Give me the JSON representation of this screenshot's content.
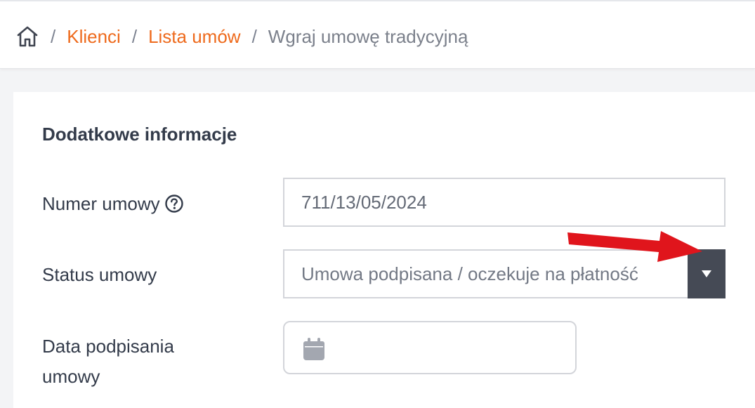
{
  "breadcrumb": {
    "home_icon": "home-icon",
    "separator": "/",
    "items": [
      {
        "label": "Klienci"
      },
      {
        "label": "Lista umów"
      }
    ],
    "current": "Wgraj umowę tradycyjną"
  },
  "form": {
    "section_title": "Dodatkowe informacje",
    "contract_number": {
      "label": "Numer umowy",
      "help_icon": "question-circle-icon",
      "value": "711/13/05/2024"
    },
    "contract_status": {
      "label": "Status umowy",
      "selected": "Umowa podpisana / oczekuje na płatność",
      "dropdown_icon": "triangle-down-icon"
    },
    "signing_date": {
      "label_line1": "Data podpisania",
      "label_line2": "umowy",
      "value": "",
      "icon": "calendar-icon"
    }
  },
  "annotation": {
    "icon": "red-arrow",
    "color": "#e0151c"
  },
  "colors": {
    "link": "#ee6a1c",
    "text": "#333b4a",
    "muted": "#7b808b",
    "dropdown_button": "#454a55"
  }
}
